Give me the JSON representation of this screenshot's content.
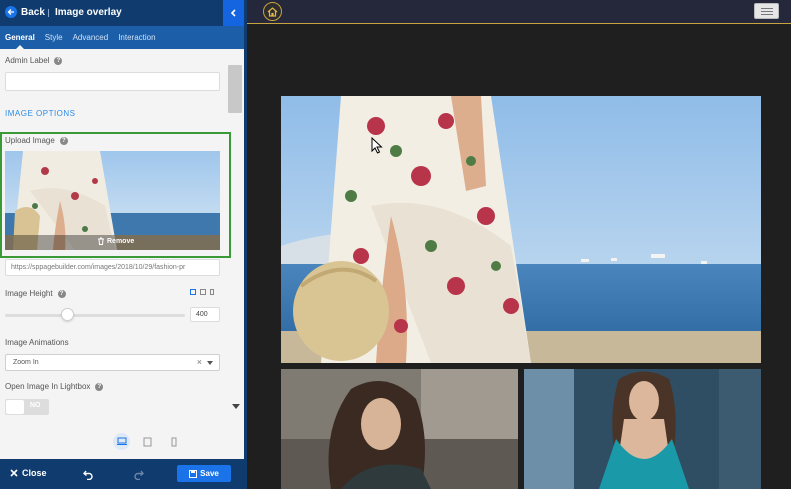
{
  "panel": {
    "back_label": "Back",
    "title": "Image overlay",
    "tabs": [
      {
        "label": "General",
        "active": true
      },
      {
        "label": "Style"
      },
      {
        "label": "Advanced"
      },
      {
        "label": "Interaction"
      }
    ],
    "admin_label": "Admin Label",
    "admin_value": "",
    "section_title": "IMAGE OPTIONS",
    "upload_label": "Upload Image",
    "remove_label": "Remove",
    "image_url": "https://sppagebuilder.com/images/2018/10/29/fashion-pr",
    "image_height_label": "Image Height",
    "image_height_value": "400",
    "image_height_fraction": 0.35,
    "animations_label": "Image Animations",
    "animation_value": "Zoom In",
    "lightbox_label": "Open Image In Lightbox",
    "lightbox_value": "NO",
    "close_label": "Close",
    "save_label": "Save"
  },
  "colors": {
    "panel_header": "#0f3b6e",
    "tab_bar": "#1c5fa8",
    "accent": "#1a73e8",
    "upload_border": "#3a9a37",
    "preview_bg": "#1f1f1f",
    "topbar_line": "#c9a33e"
  },
  "icons": {
    "back": "arrow-left-icon",
    "collapse": "chevron-left-icon",
    "help": "question-circle-icon",
    "remove": "trash-icon",
    "close": "x-icon",
    "undo": "undo-icon",
    "redo": "redo-icon",
    "save": "floppy-disk-icon",
    "home": "home-icon",
    "menu": "hamburger-icon",
    "devices": [
      "desktop-icon",
      "tablet-icon",
      "mobile-icon"
    ]
  }
}
